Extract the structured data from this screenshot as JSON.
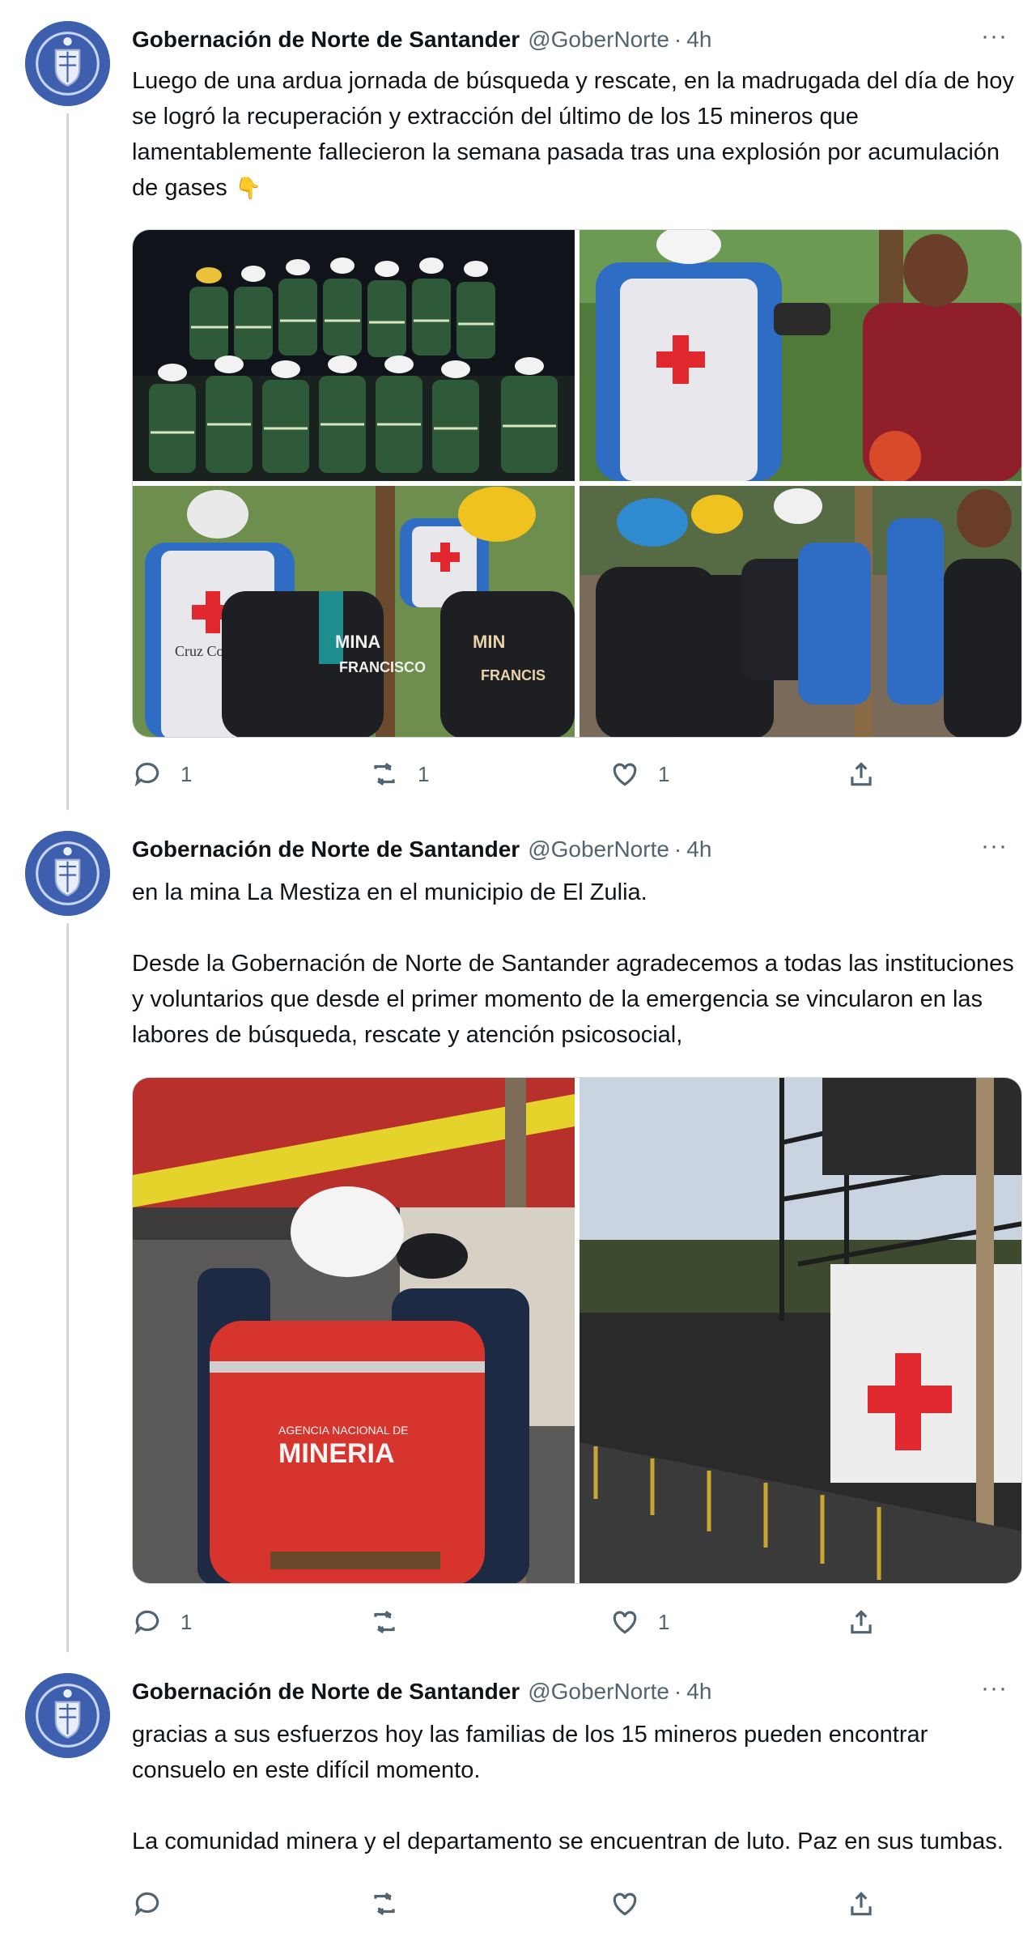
{
  "account": {
    "name": "Gobernación de Norte de Santander",
    "handle": "@GoberNorte",
    "separator": "·"
  },
  "tweets": [
    {
      "time": "4h",
      "more": "···",
      "text": "Luego de una ardua jornada de búsqueda y rescate, en la madrugada del día de hoy se logró la recuperación y extracción del último de los 15 mineros que lamentablemente fallecieron la semana pasada tras una explosión por acumulación de gases",
      "emoji": "pointing-down-hand-icon",
      "replies": "1",
      "retweets": "1",
      "likes": "1"
    },
    {
      "time": "4h",
      "more": "···",
      "text": "en la mina La Mestiza en el municipio de El Zulia.\n\nDesde la Gobernación de Norte de Santander agradecemos a todas las instituciones y voluntarios que desde el primer momento de la emergencia se vincularon en las labores de búsqueda, rescate y atención psicosocial,",
      "replies": "1",
      "retweets": "",
      "likes": "1"
    },
    {
      "time": "4h",
      "more": "···",
      "text": "gracias a sus esfuerzos hoy las familias de los 15 mineros pueden encontrar consuelo en este difícil momento.\n\nLa comunidad minera y el departamento se encuentran de luto. Paz en sus tumbas."
    }
  ],
  "photo_labels": {
    "vest_1": "Cruz Colombia",
    "shirt_1": "MINA SAN FRANCISCO",
    "shirt_2": "MINA SAN FRANCISCO",
    "agency_small": "AGENCIA NACIONAL DE",
    "agency": "MINERIA"
  },
  "colors": {
    "avatar": "#3d5fae",
    "red_cross": "#e0282e",
    "icon_gray": "#536471"
  }
}
